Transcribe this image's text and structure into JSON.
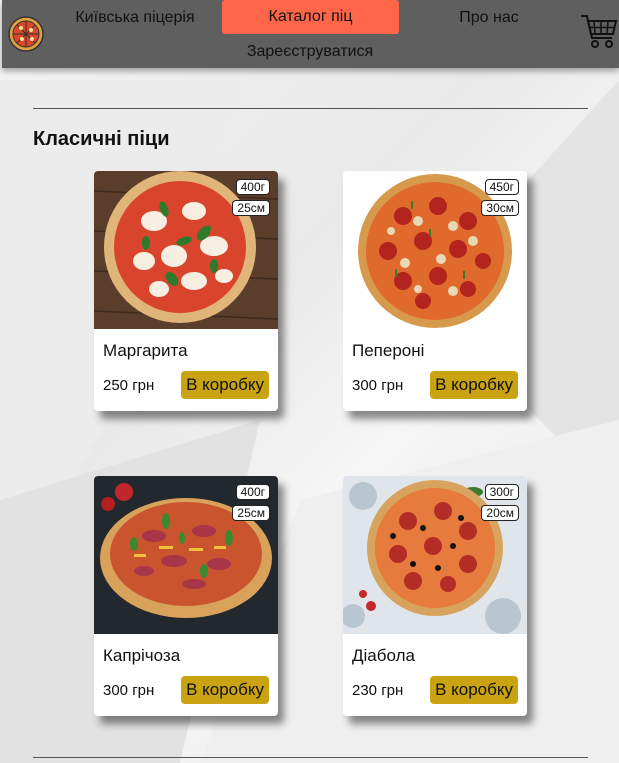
{
  "header": {
    "nav": {
      "home": "Київська піцерія",
      "catalog": "Каталог піц",
      "about": "Про нас",
      "register": "Зареєструватися"
    },
    "active_color": "#ff6548",
    "bg_color": "#5f5f5f"
  },
  "section": {
    "title": "Класичні піци"
  },
  "cards": [
    {
      "name": "Маргарита",
      "price": "250 грн",
      "weight": "400г",
      "diameter": "25см",
      "button": "В коробку"
    },
    {
      "name": "Пепероні",
      "price": "300 грн",
      "weight": "450г",
      "diameter": "30см",
      "button": "В коробку"
    },
    {
      "name": "Капрічоза",
      "price": "300 грн",
      "weight": "400г",
      "diameter": "25см",
      "button": "В коробку"
    },
    {
      "name": "Діабола",
      "price": "230 грн",
      "weight": "300г",
      "diameter": "20см",
      "button": "В коробку"
    }
  ],
  "button_color": "#c9a311",
  "icons": {
    "logo": "pizza-logo-icon",
    "cart": "shopping-cart-icon"
  }
}
